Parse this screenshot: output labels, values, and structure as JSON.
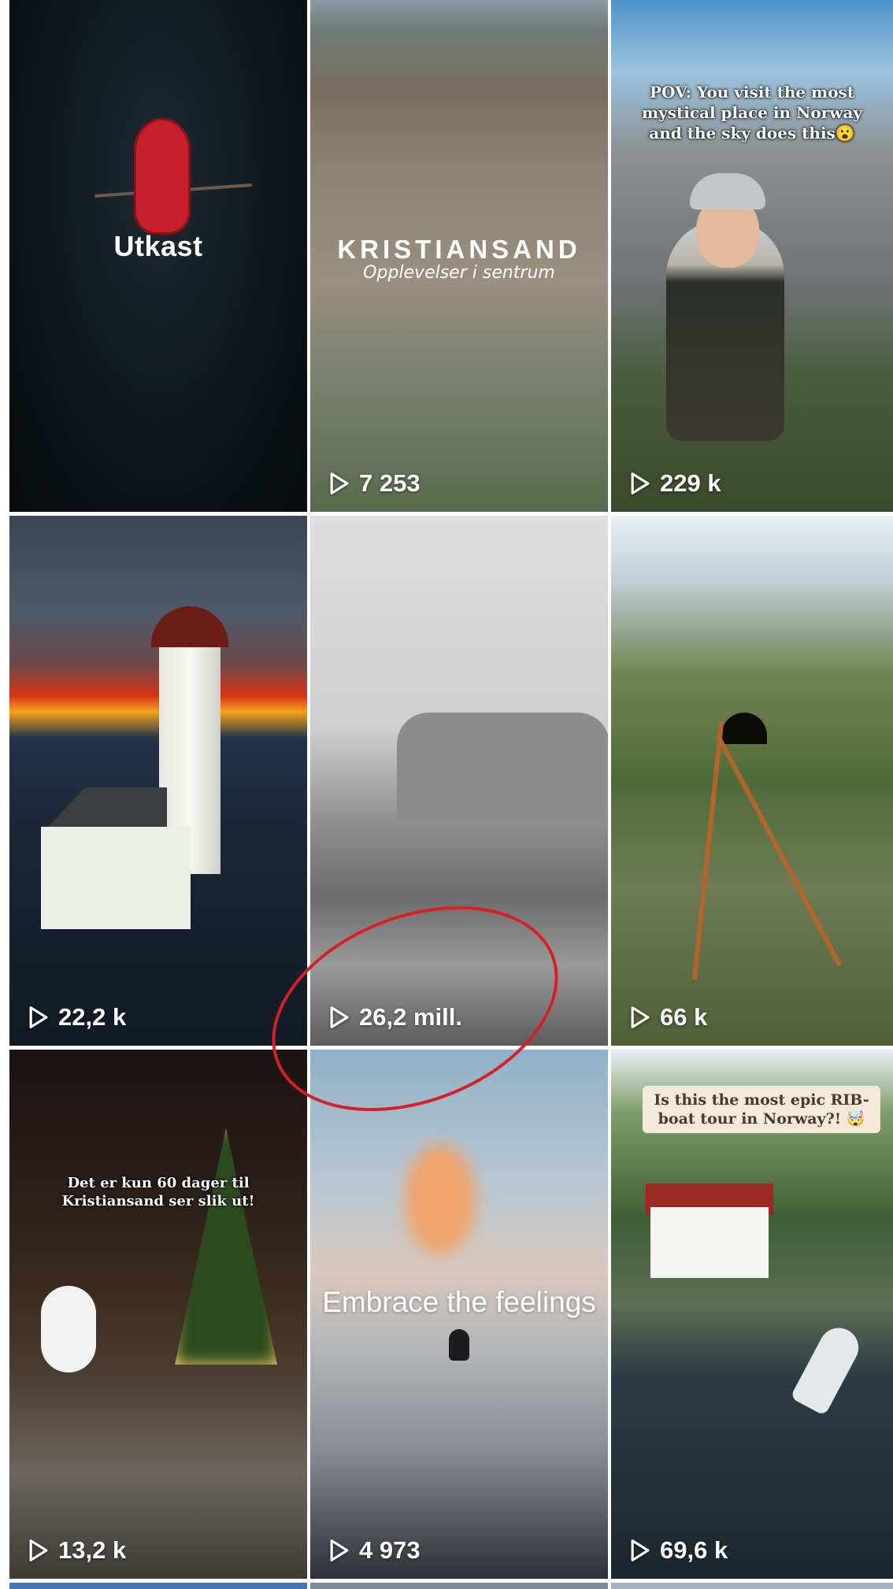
{
  "tiles": [
    {
      "kind": "draft",
      "label": "Utkast"
    },
    {
      "kind": "video",
      "title": "KRISTIANSAND",
      "subtitle": "Opplevelser i sentrum",
      "views": "7 253"
    },
    {
      "kind": "video",
      "caption": "POV: You visit the most mystical place in Norway and the sky does this😮",
      "views": "229 k"
    },
    {
      "kind": "video",
      "views": "22,2 k"
    },
    {
      "kind": "video",
      "views": "26,2 mill."
    },
    {
      "kind": "video",
      "views": "66 k"
    },
    {
      "kind": "video",
      "caption": "Det er kun 60 dager til Kristiansand ser slik ut!",
      "views": "13,2 k"
    },
    {
      "kind": "video",
      "caption": "Embrace the feelings",
      "views": "4 973"
    },
    {
      "kind": "video",
      "caption": "Is this the most epic RIB-boat tour in Norway?! 🤯",
      "views": "69,6 k"
    }
  ],
  "icons": {
    "play": "play-outline-icon"
  },
  "annotation": {
    "shape": "hand-drawn-ellipse",
    "color": "#d71f26",
    "target": "26,2 mill."
  }
}
